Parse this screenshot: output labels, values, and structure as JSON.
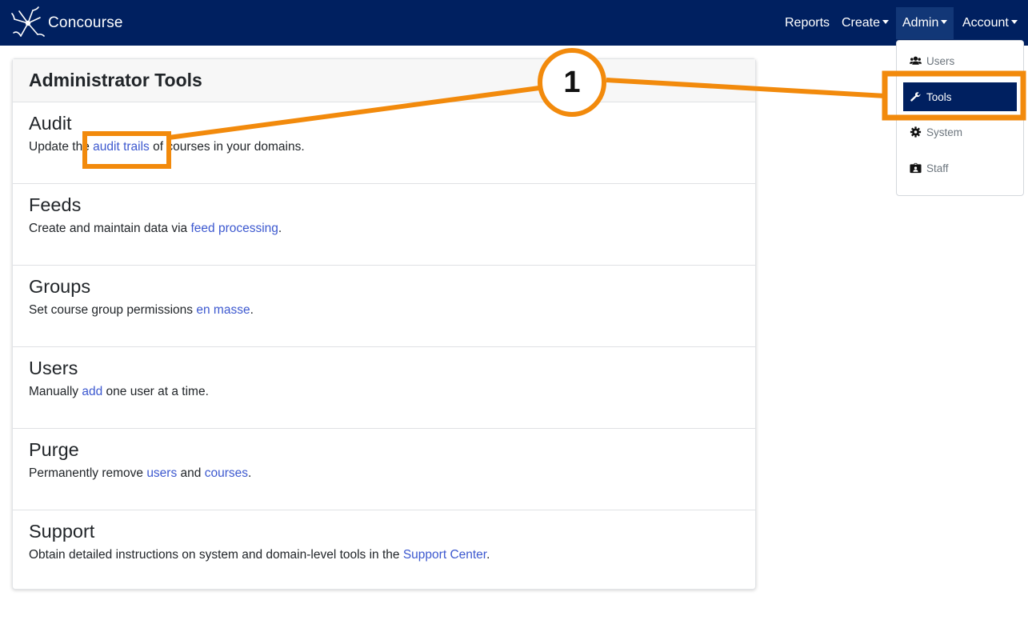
{
  "navbar": {
    "brand": "Concourse",
    "items": [
      {
        "label": "Reports"
      },
      {
        "label": "Create"
      },
      {
        "label": "Admin"
      },
      {
        "label": "Account"
      }
    ]
  },
  "admin_menu": {
    "items": [
      {
        "label": "Users",
        "icon": "users-icon"
      },
      {
        "label": "Tools",
        "icon": "wrench-icon",
        "active": true
      },
      {
        "label": "System",
        "icon": "gear-icon"
      },
      {
        "label": "Staff",
        "icon": "id-badge-icon"
      }
    ]
  },
  "card": {
    "title": "Administrator Tools",
    "sections": [
      {
        "title": "Audit",
        "pre": "Update the ",
        "link": "audit trails",
        "post": " of courses in your domains."
      },
      {
        "title": "Feeds",
        "pre": "Create and maintain data via ",
        "link": "feed processing",
        "post": "."
      },
      {
        "title": "Groups",
        "pre": "Set course group permissions ",
        "link": "en masse",
        "post": "."
      },
      {
        "title": "Users",
        "pre": "Manually ",
        "link": "add",
        "post": " one user at a time."
      },
      {
        "title": "Purge",
        "pre": "Permanently remove ",
        "link": "users",
        "mid": " and ",
        "link2": "courses",
        "post": "."
      },
      {
        "title": "Support",
        "pre": "Obtain detailed instructions on system and domain-level tools in the ",
        "link": "Support Center",
        "post": "."
      }
    ]
  },
  "annotation": {
    "callout_number": "1",
    "color": "#f28a0c"
  },
  "colors": {
    "navbar": "#002060",
    "link": "#3c58cf",
    "active_menu": "#002060"
  }
}
